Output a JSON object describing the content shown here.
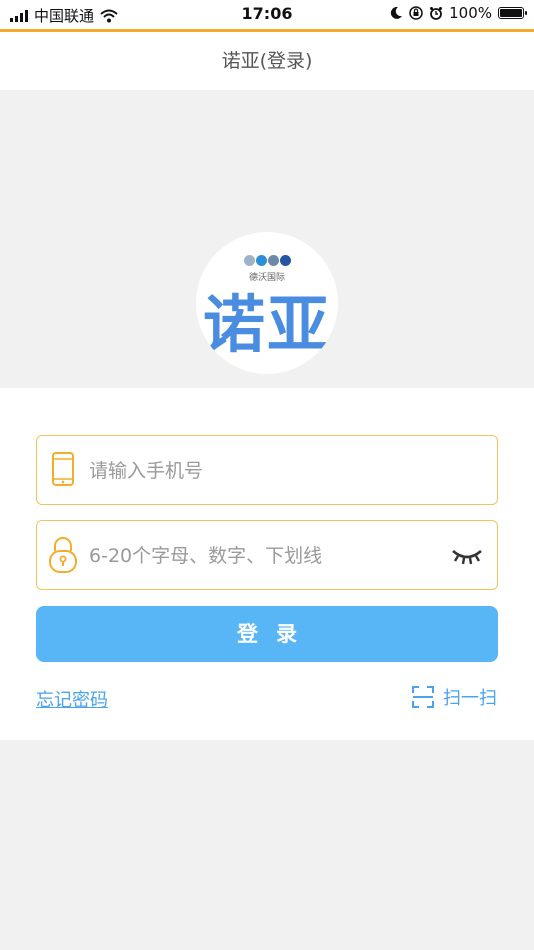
{
  "status_bar": {
    "carrier": "中国联通",
    "time": "17:06",
    "battery": "100%",
    "battery_level": 1.0
  },
  "nav": {
    "title": "诺亚(登录)"
  },
  "logo": {
    "text": "诺亚",
    "dots": [
      "#9fb3c8",
      "#2e8fd8",
      "#6c8aa8",
      "#2556a4"
    ],
    "subtitle": "德沃国际"
  },
  "form": {
    "phone_placeholder": "请输入手机号",
    "password_placeholder": "6-20个字母、数字、下划线",
    "login_label": "登录",
    "forgot_label": "忘记密码",
    "scan_label": "扫一扫"
  },
  "colors": {
    "accent": "#f3ad2c",
    "button": "#58b6f7",
    "link": "#49a3ee",
    "field_border": "#f2c45a"
  },
  "icons": {
    "phone": "phone-icon",
    "lock": "lock-icon",
    "eye": "eye-closed-icon",
    "scan": "scan-icon",
    "wifi": "wifi-icon",
    "moon": "moon-icon",
    "alarm": "alarm-icon"
  }
}
